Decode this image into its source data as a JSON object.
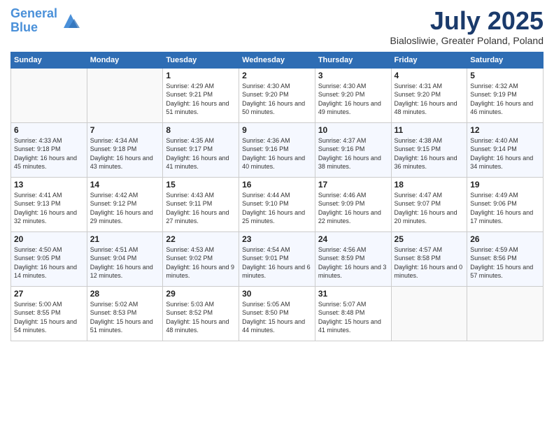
{
  "header": {
    "logo_line1": "General",
    "logo_line2": "Blue",
    "month_title": "July 2025",
    "location": "Bialosliwie, Greater Poland, Poland"
  },
  "days_of_week": [
    "Sunday",
    "Monday",
    "Tuesday",
    "Wednesday",
    "Thursday",
    "Friday",
    "Saturday"
  ],
  "weeks": [
    [
      {
        "day": "",
        "info": ""
      },
      {
        "day": "",
        "info": ""
      },
      {
        "day": "1",
        "info": "Sunrise: 4:29 AM\nSunset: 9:21 PM\nDaylight: 16 hours and 51 minutes."
      },
      {
        "day": "2",
        "info": "Sunrise: 4:30 AM\nSunset: 9:20 PM\nDaylight: 16 hours and 50 minutes."
      },
      {
        "day": "3",
        "info": "Sunrise: 4:30 AM\nSunset: 9:20 PM\nDaylight: 16 hours and 49 minutes."
      },
      {
        "day": "4",
        "info": "Sunrise: 4:31 AM\nSunset: 9:20 PM\nDaylight: 16 hours and 48 minutes."
      },
      {
        "day": "5",
        "info": "Sunrise: 4:32 AM\nSunset: 9:19 PM\nDaylight: 16 hours and 46 minutes."
      }
    ],
    [
      {
        "day": "6",
        "info": "Sunrise: 4:33 AM\nSunset: 9:18 PM\nDaylight: 16 hours and 45 minutes."
      },
      {
        "day": "7",
        "info": "Sunrise: 4:34 AM\nSunset: 9:18 PM\nDaylight: 16 hours and 43 minutes."
      },
      {
        "day": "8",
        "info": "Sunrise: 4:35 AM\nSunset: 9:17 PM\nDaylight: 16 hours and 41 minutes."
      },
      {
        "day": "9",
        "info": "Sunrise: 4:36 AM\nSunset: 9:16 PM\nDaylight: 16 hours and 40 minutes."
      },
      {
        "day": "10",
        "info": "Sunrise: 4:37 AM\nSunset: 9:16 PM\nDaylight: 16 hours and 38 minutes."
      },
      {
        "day": "11",
        "info": "Sunrise: 4:38 AM\nSunset: 9:15 PM\nDaylight: 16 hours and 36 minutes."
      },
      {
        "day": "12",
        "info": "Sunrise: 4:40 AM\nSunset: 9:14 PM\nDaylight: 16 hours and 34 minutes."
      }
    ],
    [
      {
        "day": "13",
        "info": "Sunrise: 4:41 AM\nSunset: 9:13 PM\nDaylight: 16 hours and 32 minutes."
      },
      {
        "day": "14",
        "info": "Sunrise: 4:42 AM\nSunset: 9:12 PM\nDaylight: 16 hours and 29 minutes."
      },
      {
        "day": "15",
        "info": "Sunrise: 4:43 AM\nSunset: 9:11 PM\nDaylight: 16 hours and 27 minutes."
      },
      {
        "day": "16",
        "info": "Sunrise: 4:44 AM\nSunset: 9:10 PM\nDaylight: 16 hours and 25 minutes."
      },
      {
        "day": "17",
        "info": "Sunrise: 4:46 AM\nSunset: 9:09 PM\nDaylight: 16 hours and 22 minutes."
      },
      {
        "day": "18",
        "info": "Sunrise: 4:47 AM\nSunset: 9:07 PM\nDaylight: 16 hours and 20 minutes."
      },
      {
        "day": "19",
        "info": "Sunrise: 4:49 AM\nSunset: 9:06 PM\nDaylight: 16 hours and 17 minutes."
      }
    ],
    [
      {
        "day": "20",
        "info": "Sunrise: 4:50 AM\nSunset: 9:05 PM\nDaylight: 16 hours and 14 minutes."
      },
      {
        "day": "21",
        "info": "Sunrise: 4:51 AM\nSunset: 9:04 PM\nDaylight: 16 hours and 12 minutes."
      },
      {
        "day": "22",
        "info": "Sunrise: 4:53 AM\nSunset: 9:02 PM\nDaylight: 16 hours and 9 minutes."
      },
      {
        "day": "23",
        "info": "Sunrise: 4:54 AM\nSunset: 9:01 PM\nDaylight: 16 hours and 6 minutes."
      },
      {
        "day": "24",
        "info": "Sunrise: 4:56 AM\nSunset: 8:59 PM\nDaylight: 16 hours and 3 minutes."
      },
      {
        "day": "25",
        "info": "Sunrise: 4:57 AM\nSunset: 8:58 PM\nDaylight: 16 hours and 0 minutes."
      },
      {
        "day": "26",
        "info": "Sunrise: 4:59 AM\nSunset: 8:56 PM\nDaylight: 15 hours and 57 minutes."
      }
    ],
    [
      {
        "day": "27",
        "info": "Sunrise: 5:00 AM\nSunset: 8:55 PM\nDaylight: 15 hours and 54 minutes."
      },
      {
        "day": "28",
        "info": "Sunrise: 5:02 AM\nSunset: 8:53 PM\nDaylight: 15 hours and 51 minutes."
      },
      {
        "day": "29",
        "info": "Sunrise: 5:03 AM\nSunset: 8:52 PM\nDaylight: 15 hours and 48 minutes."
      },
      {
        "day": "30",
        "info": "Sunrise: 5:05 AM\nSunset: 8:50 PM\nDaylight: 15 hours and 44 minutes."
      },
      {
        "day": "31",
        "info": "Sunrise: 5:07 AM\nSunset: 8:48 PM\nDaylight: 15 hours and 41 minutes."
      },
      {
        "day": "",
        "info": ""
      },
      {
        "day": "",
        "info": ""
      }
    ]
  ]
}
